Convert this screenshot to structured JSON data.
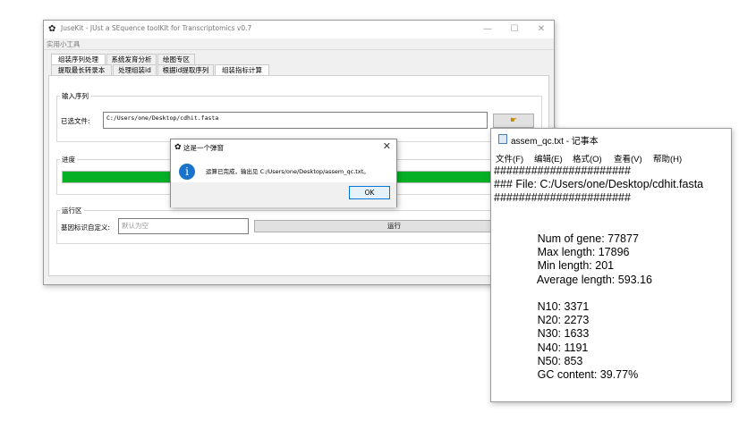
{
  "main_window": {
    "title": "JuseKit - JUst a SEquence toolKIt for Transcriptomics v0.7",
    "app_icon": "gear-icon",
    "controls": {
      "minimize": "—",
      "maximize": "☐",
      "close": "✕"
    },
    "menu": {
      "tools": "实用小工具"
    },
    "tabs": [
      {
        "label": "组装序列处理",
        "active": true
      },
      {
        "label": "系统发育分析",
        "active": false
      },
      {
        "label": "绘图专区",
        "active": false
      }
    ],
    "subtabs": [
      {
        "label": "提取最长转录本",
        "active": false
      },
      {
        "label": "处理组装id",
        "active": false
      },
      {
        "label": "根据id提取序列",
        "active": false
      },
      {
        "label": "组装指标计算",
        "active": true
      }
    ],
    "input_group": {
      "label": "输入序列",
      "file_label": "已选文件:",
      "file_value": "C:/Users/one/Desktop/cdhit.fasta",
      "browse_icon": "pointer-icon"
    },
    "progress_group": {
      "label": "进度",
      "percent": 100
    },
    "run_group": {
      "label": "运行区",
      "gene_label": "基因标识自定义:",
      "gene_placeholder": "默认为空",
      "run_button": "运行"
    }
  },
  "dialog": {
    "title": "这是一个弹窗",
    "icon": "info-icon",
    "message": "运算已完成，输出见 C:/Users/one/Desktop/assem_qc.txt。",
    "ok": "OK",
    "close": "✕"
  },
  "notepad": {
    "title": "assem_qc.txt - 记事本",
    "menus": [
      "文件(F)",
      "编辑(E)",
      "格式(O)",
      "查看(V)",
      "帮助(H)"
    ],
    "lines": [
      "######################",
      "### File: C:/Users/one/Desktop/cdhit.fasta",
      "######################",
      "",
      "",
      "              Num of gene: 77877",
      "              Max length: 17896",
      "              Min length: 201",
      "              Average length: 593.16",
      "",
      "              N10: 3371",
      "              N20: 2273",
      "              N30: 1633",
      "              N40: 1191",
      "              N50: 853",
      "              GC content: 39.77%"
    ]
  }
}
